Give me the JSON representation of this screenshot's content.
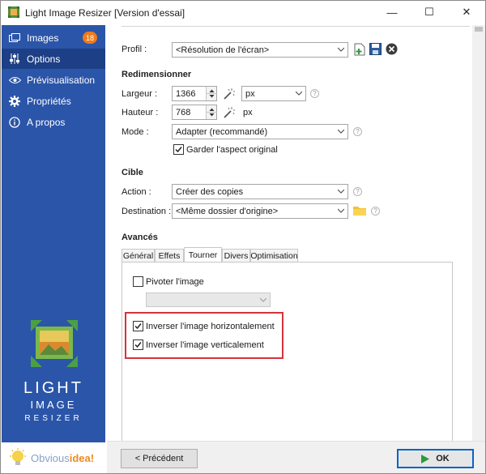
{
  "window": {
    "title": "Light Image Resizer  [Version d'essai]",
    "minimize": "—",
    "maximize": "☐",
    "close": "✕"
  },
  "sidebar": {
    "items": [
      {
        "label": "Images",
        "icon": "images-icon",
        "badge": "18"
      },
      {
        "label": "Options",
        "icon": "sliders-icon",
        "active": true
      },
      {
        "label": "Prévisualisation",
        "icon": "eye-icon"
      },
      {
        "label": "Propriétés",
        "icon": "gear-icon"
      },
      {
        "label": "A propos",
        "icon": "info-icon"
      }
    ],
    "logo_line1": "LIGHT",
    "logo_line2": "IMAGE",
    "logo_line3": "RESIZER",
    "brand_prefix": "Obvious",
    "brand_suffix": "idea!"
  },
  "options": {
    "profile_label": "Profil :",
    "profile_value": "<Résolution de l'écran>",
    "resize_heading": "Redimensionner",
    "width_label": "Largeur :",
    "width_value": "1366",
    "height_label": "Hauteur :",
    "height_value": "768",
    "unit_value": "px",
    "unit_label": "px",
    "mode_label": "Mode :",
    "mode_value": "Adapter (recommandé)",
    "keep_aspect_label": "Garder l'aspect original",
    "keep_aspect_checked": true,
    "target_heading": "Cible",
    "action_label": "Action :",
    "action_value": "Créer des copies",
    "destination_label": "Destination :",
    "destination_value": "<Même dossier d'origine>",
    "advanced_heading": "Avancés",
    "tabs": [
      "Général",
      "Effets",
      "Tourner",
      "Divers",
      "Optimisation"
    ],
    "active_tab": "Tourner",
    "rotate_label": "Pivoter l'image",
    "rotate_checked": false,
    "flip_h_label": "Inverser l'image horizontalement",
    "flip_h_checked": true,
    "flip_v_label": "Inverser l'image verticalement",
    "flip_v_checked": true
  },
  "footer": {
    "back_label": "< Précédent",
    "ok_label": "OK"
  },
  "colors": {
    "sidebar": "#2b55a8",
    "sidebar_active": "#1d3f86",
    "badge": "#f07a1a",
    "highlight_box": "#d6323a",
    "ok_border": "#0a63c8"
  }
}
